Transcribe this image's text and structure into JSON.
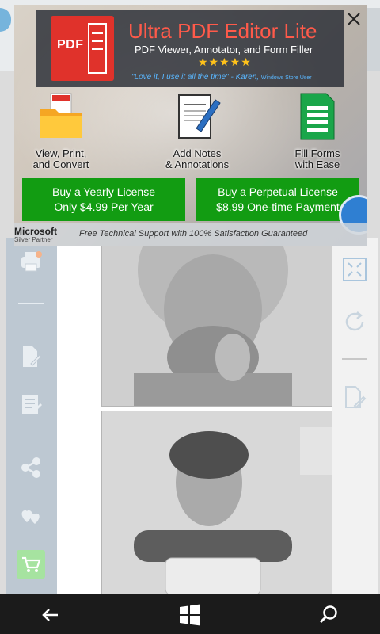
{
  "ad": {
    "logo_label": "PDF",
    "title": "Ultra PDF Editor Lite",
    "subtitle": "PDF Viewer, Annotator, and Form Filler",
    "stars": "★★★★★",
    "quote": "\"Love it, I use it all the time\" - Karen,",
    "quote_source": "Windows Store User",
    "features": [
      {
        "label": "View, Print,\nand Convert",
        "icon": "folder-pdf-icon"
      },
      {
        "label": "Add Notes\n& Annotations",
        "icon": "document-pen-icon"
      },
      {
        "label": "Fill Forms\nwith Ease",
        "icon": "form-sheet-icon"
      }
    ],
    "buttons": {
      "yearly_line1": "Buy a Yearly License",
      "yearly_line2": "Only $4.99 Per Year",
      "perpetual_line1": "Buy a Perpetual License",
      "perpetual_line2": "$8.99 One-time Payment"
    },
    "partner_name": "Microsoft",
    "partner_sub": "Silver Partner",
    "footer": "Free Technical Support with 100% Satisfaction Guaranteed"
  },
  "colors": {
    "buy_button": "#129c12",
    "title_red": "#ff5a4a",
    "quote_blue": "#5ab7ff",
    "stars": "#ffc21a",
    "left_rail": "#bdc8d2"
  },
  "left_rail_icons": [
    "print-icon",
    "edit-page-icon",
    "notes-icon",
    "share-icon",
    "hearts-icon",
    "cart-icon"
  ],
  "right_rail_icons": [
    "fit-screen-icon",
    "rotate-icon",
    "annotate-icon"
  ],
  "navbar_icons": [
    "back-arrow-icon",
    "windows-icon",
    "search-icon"
  ]
}
